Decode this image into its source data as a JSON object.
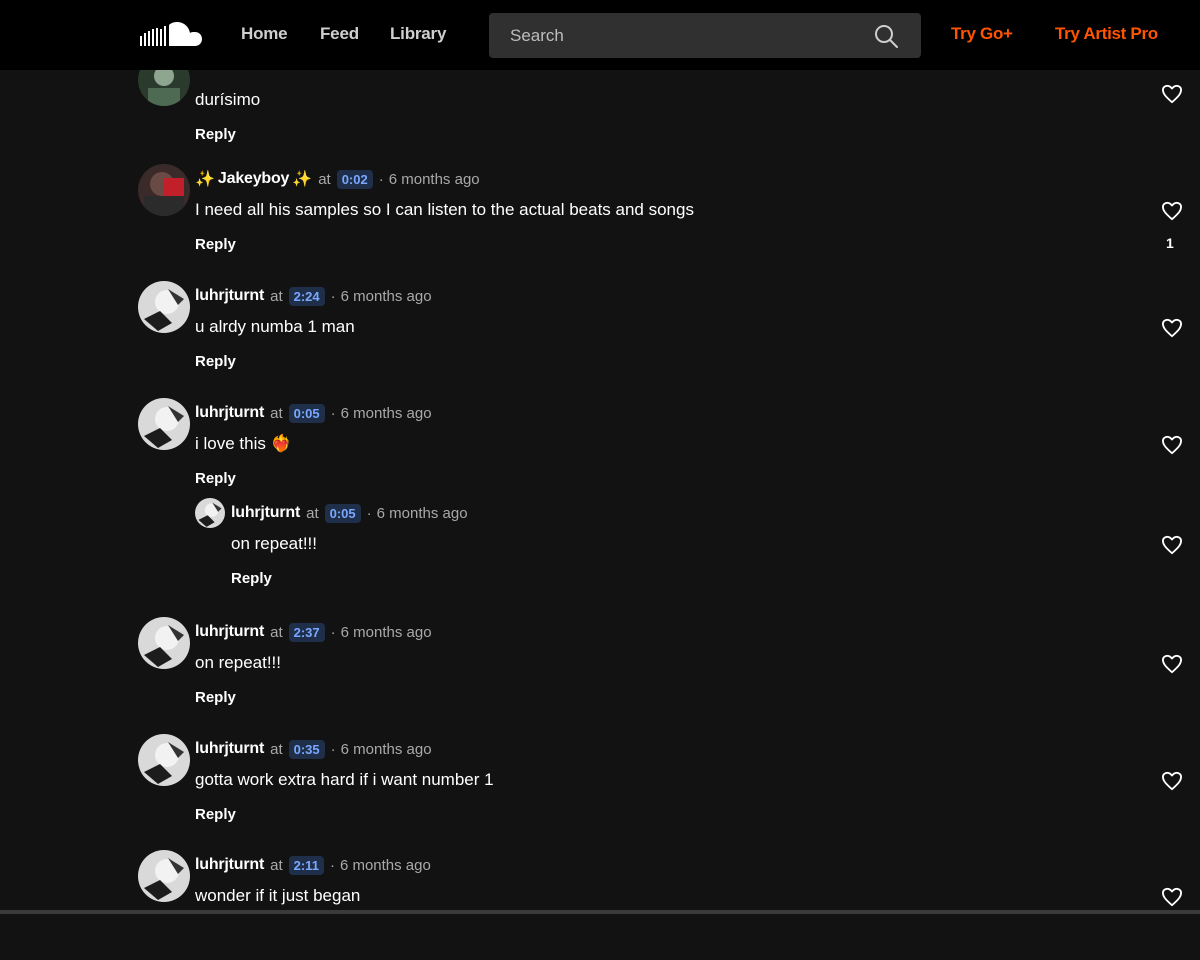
{
  "header": {
    "nav": [
      "Home",
      "Feed",
      "Library"
    ],
    "search_placeholder": "Search",
    "try_go": "Try Go+",
    "try_artist": "Try Artist Pro"
  },
  "colors": {
    "brand": "#ff5500",
    "background": "#121212",
    "timestamp_bg": "#1f2f4a",
    "timestamp_fg": "#7aa8ff"
  },
  "comments": [
    {
      "user": "",
      "at": "",
      "timestamp": "",
      "ago": "",
      "text": "durísimo",
      "reply": "Reply",
      "likes": ""
    },
    {
      "user": "Jakeyboy",
      "at": "at",
      "timestamp": "0:02",
      "ago": "6 months ago",
      "text": "I need all his samples so I can listen to the actual beats and songs",
      "reply": "Reply",
      "likes": "1"
    },
    {
      "user": "luhrjturnt",
      "at": "at",
      "timestamp": "2:24",
      "ago": "6 months ago",
      "text": "u alrdy numba 1 man",
      "reply": "Reply",
      "likes": ""
    },
    {
      "user": "luhrjturnt",
      "at": "at",
      "timestamp": "0:05",
      "ago": "6 months ago",
      "text": "i love this ❤️‍🔥",
      "reply": "Reply",
      "likes": ""
    },
    {
      "user": "luhrjturnt",
      "at": "at",
      "timestamp": "0:05",
      "ago": "6 months ago",
      "text": "on repeat!!!",
      "reply": "Reply",
      "likes": ""
    },
    {
      "user": "luhrjturnt",
      "at": "at",
      "timestamp": "2:37",
      "ago": "6 months ago",
      "text": "on repeat!!!",
      "reply": "Reply",
      "likes": ""
    },
    {
      "user": "luhrjturnt",
      "at": "at",
      "timestamp": "0:35",
      "ago": "6 months ago",
      "text": "gotta work extra hard if i want number 1",
      "reply": "Reply",
      "likes": ""
    },
    {
      "user": "luhrjturnt",
      "at": "at",
      "timestamp": "2:11",
      "ago": "6 months ago",
      "text": "wonder if it just began",
      "reply": "Reply",
      "likes": ""
    }
  ]
}
